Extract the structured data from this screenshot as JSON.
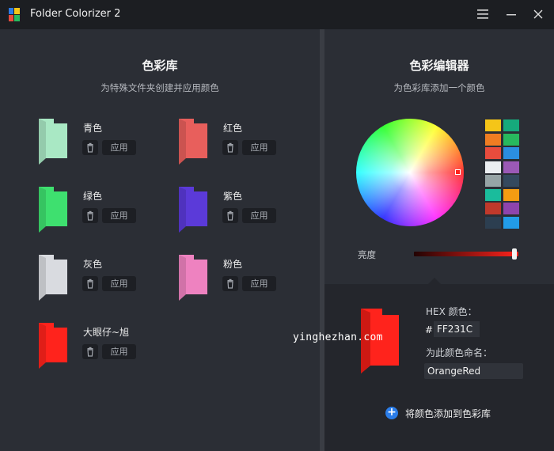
{
  "titlebar": {
    "title": "Folder Colorizer 2",
    "menu_icon": "menu-icon",
    "minimize_icon": "minimize-icon",
    "close_icon": "close-icon"
  },
  "library": {
    "title": "色彩库",
    "subtitle": "为特殊文件夹创建并应用颜色",
    "apply_label": "应用",
    "delete_icon": "trash-icon",
    "items": [
      {
        "name": "青色",
        "color": "#a9e8c4"
      },
      {
        "name": "红色",
        "color": "#e85f5c"
      },
      {
        "name": "绿色",
        "color": "#3ee06f"
      },
      {
        "name": "紫色",
        "color": "#5b3ad9"
      },
      {
        "name": "灰色",
        "color": "#d9dbe0"
      },
      {
        "name": "粉色",
        "color": "#ee82c0"
      },
      {
        "name": "大眼仔~旭",
        "color": "#ff231c"
      }
    ]
  },
  "editor": {
    "title": "色彩编辑器",
    "subtitle": "为色彩库添加一个颜色",
    "palette": [
      "#f5c518",
      "#16a97c",
      "#ef7d22",
      "#28b95e",
      "#e84c3d",
      "#2b8ee0",
      "#eceff2",
      "#9b59b6",
      "#97a4a6",
      "#34495e",
      "#1abc9c",
      "#f39c12",
      "#c0392b",
      "#8e44ad",
      "#2c3e50",
      "#229ce8"
    ],
    "brightness_label": "亮度",
    "brightness": 0.96,
    "hex_label": "HEX 颜色：",
    "hash": "#",
    "hex_value": "FF231C",
    "name_label": "为此颜色命名：",
    "name_value": "OrangeRed",
    "add_label": "将颜色添加到色彩库",
    "preview_color": "#ff231c"
  },
  "watermark": "yinghezhan.com"
}
